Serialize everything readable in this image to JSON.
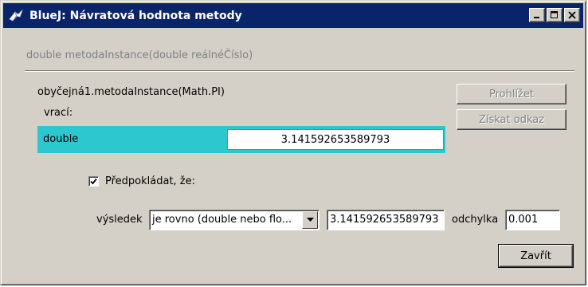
{
  "window": {
    "title": "BlueJ:  Návratová hodnota metody",
    "icon": "bluej-bird-icon",
    "controls": [
      "minimize",
      "maximize",
      "close"
    ]
  },
  "signature": "double metodaInstance(double reálnéČíslo)",
  "call_expression": "obyčejná1.metodaInstance(Math.PI)",
  "returns_label": "vrací:",
  "result": {
    "type": "double",
    "value": "3.141592653589793",
    "highlight_color": "#2dc7cf"
  },
  "buttons": {
    "inspect": "Prohlížet",
    "get_reference": "Získat odkaz",
    "close": "Zavřít"
  },
  "assertion": {
    "checkbox_label": "Předpokládat, že:",
    "checked": true,
    "result_label": "výsledek",
    "comparison_selected": "je rovno (double nebo flo...",
    "expected_value": "3.141592653589793",
    "tolerance_label": "odchylka",
    "tolerance_value": "0.001"
  }
}
